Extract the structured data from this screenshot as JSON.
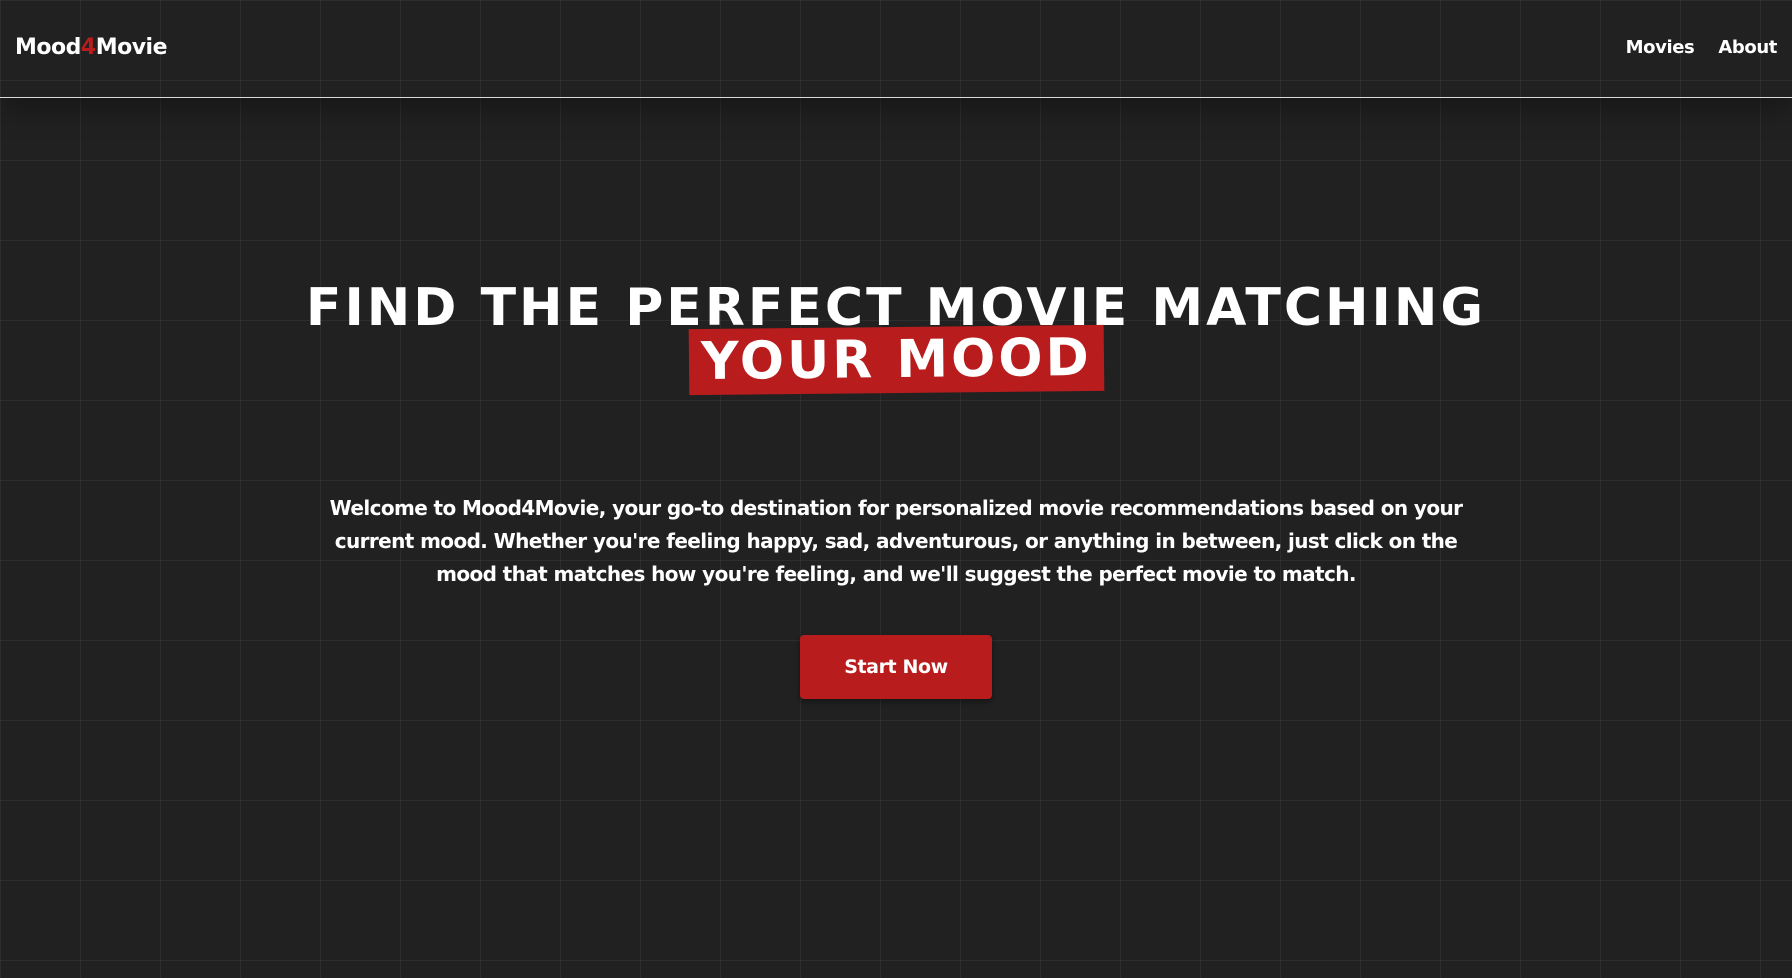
{
  "brand": {
    "name_part1": "Mood",
    "name_accent": "4",
    "name_part2": "Movie",
    "accent_color": "#b91c1c"
  },
  "nav": {
    "items": [
      {
        "label": "Movies"
      },
      {
        "label": "About"
      }
    ]
  },
  "hero": {
    "headline": "FIND THE PERFECT MOVIE MATCHING",
    "highlight": "YOUR MOOD",
    "intro": "Welcome to Mood4Movie, your go-to destination for personalized movie recommendations based on your current mood. Whether you're feeling happy, sad, adventurous, or anything in between, just click on the mood that matches how you're feeling, and we'll suggest the perfect movie to match.",
    "cta_label": "Start Now"
  },
  "colors": {
    "background": "#212121",
    "text": "#ffffff",
    "accent": "#b91c1c"
  }
}
